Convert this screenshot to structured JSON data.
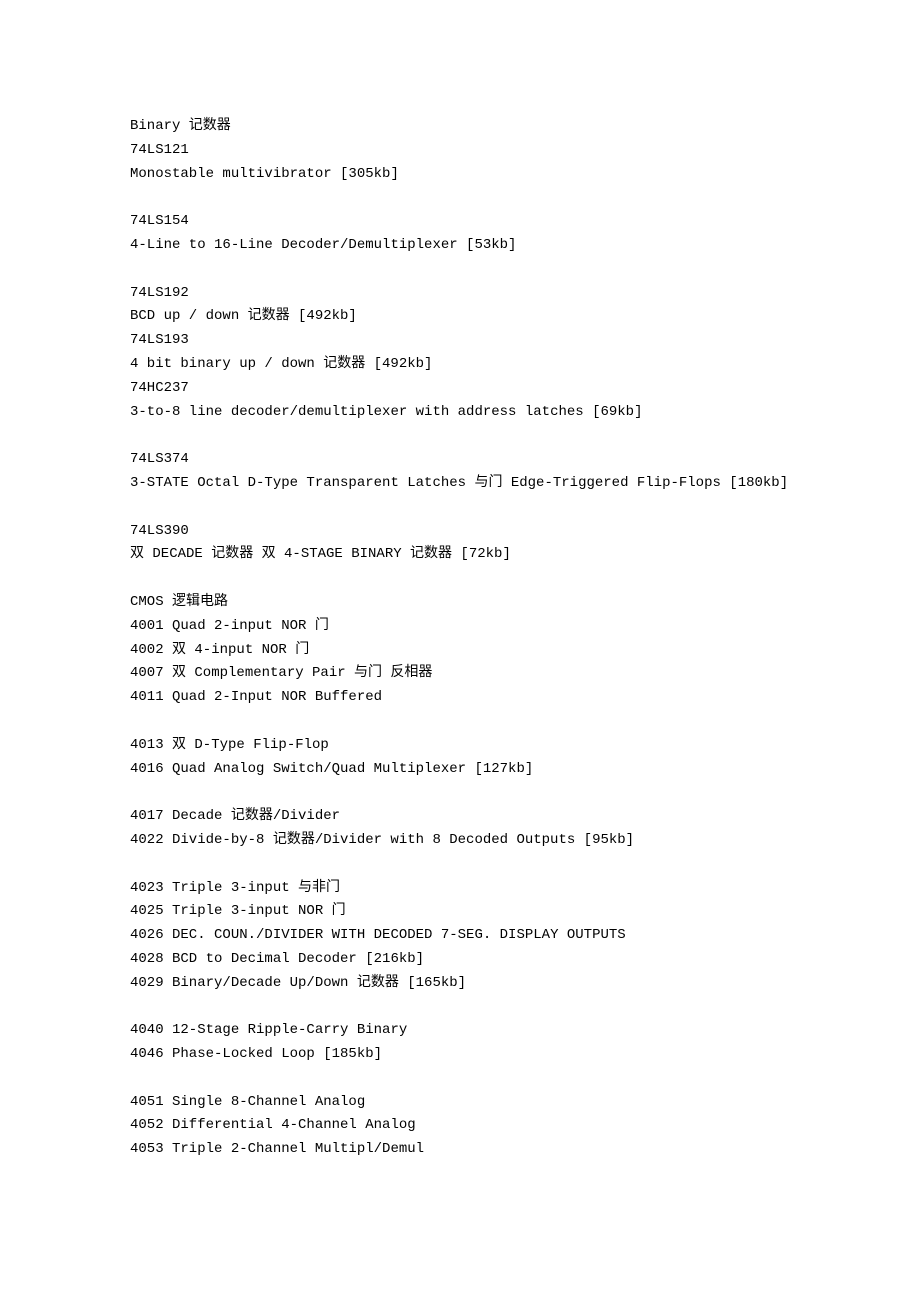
{
  "lines": [
    "Binary 记数器",
    "74LS121",
    "Monostable multivibrator [305kb]",
    "",
    "74LS154",
    "4-Line to 16-Line Decoder/Demultiplexer [53kb]",
    "",
    "74LS192",
    "BCD up / down 记数器 [492kb]",
    "74LS193",
    "4 bit binary up / down 记数器 [492kb]",
    "74HC237",
    "3-to-8 line decoder/demultiplexer with address latches [69kb]",
    "",
    "74LS374",
    "3-STATE Octal D-Type Transparent Latches 与门 Edge-Triggered Flip-Flops [180kb]",
    "",
    "74LS390",
    "双 DECADE 记数器 双 4-STAGE BINARY 记数器 [72kb]",
    "",
    "CMOS 逻辑电路",
    "4001 Quad 2-input NOR 门",
    "4002 双 4-input NOR 门",
    "4007 双 Complementary Pair 与门 反相器",
    "4011 Quad 2-Input NOR Buffered",
    "",
    "4013 双 D-Type Flip-Flop",
    "4016 Quad Analog Switch/Quad Multiplexer [127kb]",
    "",
    "4017 Decade 记数器/Divider",
    "4022 Divide-by-8 记数器/Divider with 8 Decoded Outputs [95kb]",
    "",
    "4023 Triple 3-input 与非门",
    "4025 Triple 3-input NOR 门",
    "4026 DEC. COUN./DIVIDER WITH DECODED 7-SEG. DISPLAY OUTPUTS",
    "4028 BCD to Decimal Decoder [216kb]",
    "4029 Binary/Decade Up/Down 记数器 [165kb]",
    "",
    "4040 12-Stage Ripple-Carry Binary",
    "4046 Phase-Locked Loop [185kb]",
    "",
    "4051 Single 8-Channel Analog",
    "4052 Differential 4-Channel Analog",
    "4053 Triple 2-Channel Multipl/Demul"
  ]
}
